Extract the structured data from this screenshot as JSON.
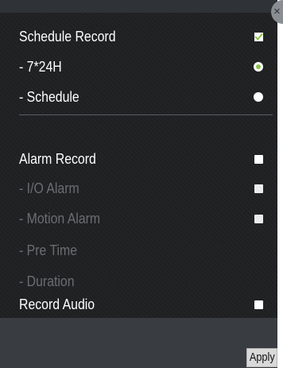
{
  "header": {
    "close_glyph": "×",
    "close_icon": "close-icon"
  },
  "schedule": {
    "label": "Schedule Record",
    "checked": true,
    "mode_24h": {
      "label": "- 7*24H",
      "selected": true
    },
    "mode_schedule": {
      "label": "- Schedule",
      "selected": false
    }
  },
  "alarm": {
    "label": "Alarm Record",
    "checked": false,
    "io_alarm": {
      "label": "- I/O Alarm",
      "checked": false,
      "disabled": true
    },
    "motion_alarm": {
      "label": "- Motion Alarm",
      "checked": false,
      "disabled": true
    },
    "pre_time": {
      "label": "- Pre Time",
      "disabled": true
    },
    "duration": {
      "label": "- Duration",
      "disabled": true
    }
  },
  "audio": {
    "label": "Record Audio",
    "checked": false
  },
  "footer": {
    "apply_label": "Apply"
  },
  "colors": {
    "panel_bg": "#1f2022",
    "footer_bg": "#393c40",
    "check_green": "#8bc34a",
    "disabled_text": "#6b6d70"
  }
}
